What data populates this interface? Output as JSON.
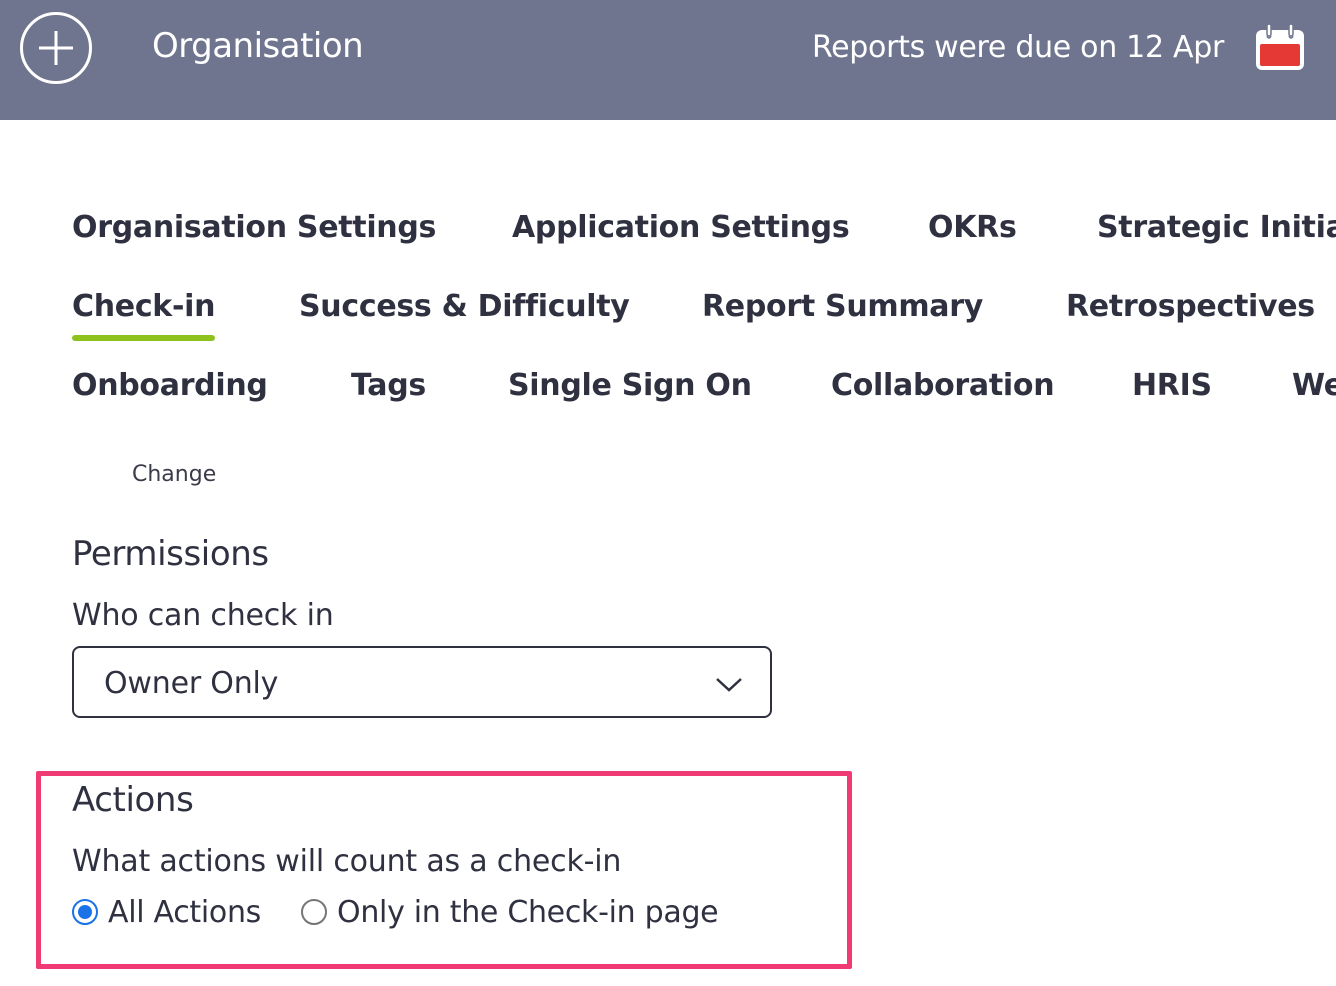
{
  "header": {
    "title": "Organisation",
    "due_text": "Reports were due on 12 Apr",
    "add_icon": "plus-circle-icon",
    "calendar_icon": "calendar-icon",
    "calendar_accent": "#e53935"
  },
  "tabs": {
    "row1": [
      "Organisation Settings",
      "Application Settings",
      "OKRs",
      "Strategic Initia"
    ],
    "row2": [
      "Check-in",
      "Success & Difficulty",
      "Report Summary",
      "Retrospectives"
    ],
    "row3": [
      "Onboarding",
      "Tags",
      "Single Sign On",
      "Collaboration",
      "HRIS",
      "We"
    ],
    "active": "Check-in",
    "active_color": "#8ec21f"
  },
  "change_link": "Change",
  "permissions": {
    "heading": "Permissions",
    "label": "Who can check in",
    "selected": "Owner Only"
  },
  "actions": {
    "heading": "Actions",
    "label": "What actions will count as a check-in",
    "options": [
      "All Actions",
      "Only in the Check-in page"
    ],
    "selected": "All Actions",
    "highlight_color": "#f03a74"
  }
}
